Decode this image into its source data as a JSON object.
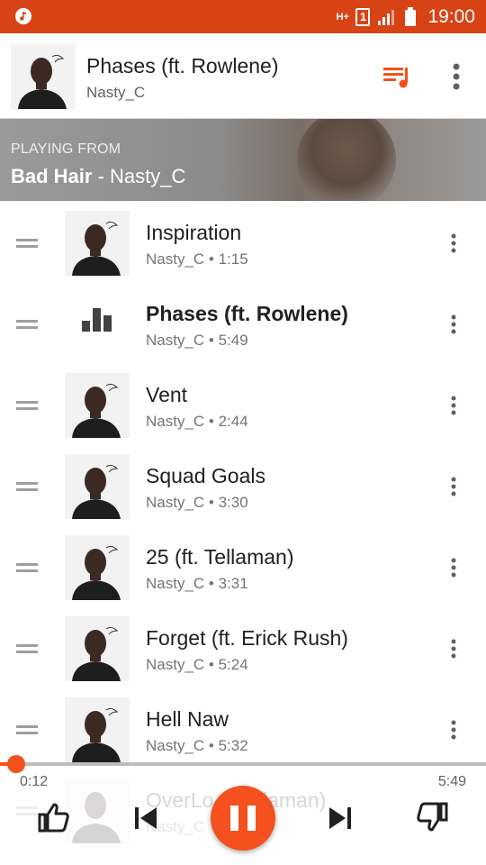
{
  "status_bar": {
    "left_icon": "music-note-icon",
    "network_label": "H+",
    "sim_slot": "1",
    "signal_icon": "signal-bars-icon",
    "battery_icon": "battery-icon",
    "time": "19:00"
  },
  "now_playing": {
    "title": "Phases (ft. Rowlene)",
    "artist": "Nasty_C",
    "queue_icon": "queue-music-icon",
    "menu_icon": "more-vert-icon"
  },
  "playing_from": {
    "label": "PLAYING FROM",
    "album": "Bad Hair",
    "separator": " - ",
    "artist": "Nasty_C"
  },
  "queue": [
    {
      "title": "Inspiration",
      "subtitle": "Nasty_C • 1:15",
      "playing": false
    },
    {
      "title": "Phases (ft. Rowlene)",
      "subtitle": "Nasty_C • 5:49",
      "playing": true
    },
    {
      "title": "Vent",
      "subtitle": "Nasty_C • 2:44",
      "playing": false
    },
    {
      "title": "Squad Goals",
      "subtitle": "Nasty_C • 3:30",
      "playing": false
    },
    {
      "title": "25 (ft. Tellaman)",
      "subtitle": "Nasty_C • 3:31",
      "playing": false
    },
    {
      "title": "Forget (ft. Erick Rush)",
      "subtitle": "Nasty_C • 5:24",
      "playing": false
    },
    {
      "title": "Hell Naw",
      "subtitle": "Nasty_C • 5:32",
      "playing": false
    },
    {
      "title": "OverLo... Tellaman)",
      "subtitle": "Nasty_C",
      "playing": false
    }
  ],
  "player": {
    "elapsed": "0:12",
    "duration": "5:49",
    "progress_fraction": 0.034,
    "accent_color": "#f4511e"
  }
}
